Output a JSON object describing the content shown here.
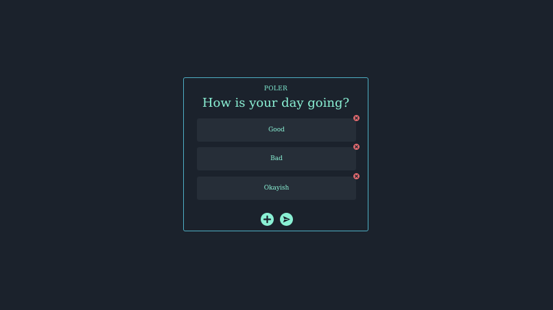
{
  "app": {
    "brand": "POLER"
  },
  "poll": {
    "question": "How is your day going?",
    "options": [
      {
        "label": "Good"
      },
      {
        "label": "Bad"
      },
      {
        "label": "Okayish"
      }
    ]
  },
  "icons": {
    "remove": "remove-x-icon",
    "add": "plus-icon",
    "submit": "send-arrow-icon"
  },
  "colors": {
    "background": "#1b222c",
    "card_border": "#4fb0c6",
    "accent": "#8af0d4",
    "option_bg": "#262e38",
    "remove": "#e56b70"
  }
}
